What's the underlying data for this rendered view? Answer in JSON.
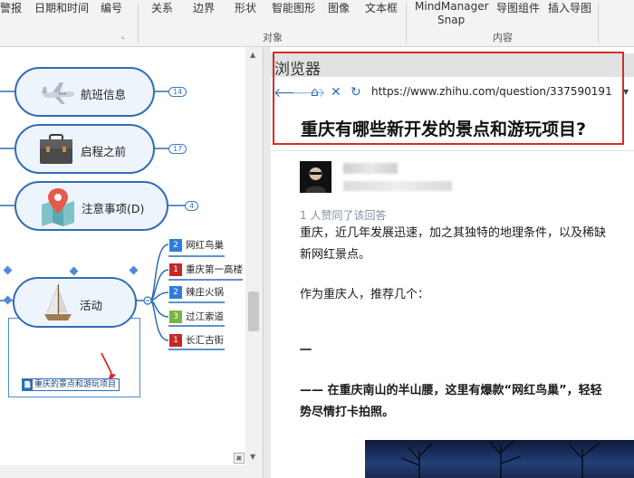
{
  "ribbon": {
    "items": [
      "警报",
      "日期和时间",
      "编号",
      "关系",
      "边界",
      "形状",
      "智能图形",
      "图像",
      "文本框",
      "MindManager",
      "Snap",
      "导图组件",
      "插入导图"
    ],
    "groups": [
      "对象",
      "内容"
    ]
  },
  "mindmap": {
    "nodes": [
      {
        "label": "航班信息",
        "badge": "14",
        "icon": "airplane-icon"
      },
      {
        "label": "启程之前",
        "badge": "17",
        "icon": "briefcase-icon"
      },
      {
        "label": "注意事项(D)",
        "badge": "4",
        "icon": "map-pin-icon"
      },
      {
        "label": "活动",
        "icon": "sailboat-icon"
      }
    ],
    "subtopics": [
      {
        "num": "2",
        "color": "blue",
        "label": "网红鸟巢"
      },
      {
        "num": "1",
        "color": "red",
        "label": "重庆第一高楼"
      },
      {
        "num": "2",
        "color": "blue",
        "label": "辣庄火锅"
      },
      {
        "num": "3",
        "color": "green",
        "label": "过江索道"
      },
      {
        "num": "1",
        "color": "red",
        "label": "长汇古街"
      }
    ],
    "note": "重庆的景点和游玩项目"
  },
  "browser": {
    "title": "浏览器",
    "url": "https://www.zhihu.com/question/337590191",
    "question": "重庆有哪些新开发的景点和游玩项目?",
    "likes": "1 人赞同了该回答",
    "p1_line1": "重庆，近几年发展迅速，加之其独特的地理条件，以及稀缺",
    "p1_line2": "新网红景点。",
    "p2": "作为重庆人，推荐几个：",
    "p3": "一",
    "p4_line1": "—— 在重庆南山的半山腰，这里有爆款“网红鸟巢”，轻轻",
    "p4_line2": "势尽情打卡拍照。"
  },
  "colors": {
    "accent": "#2f6db5",
    "highlight": "#d62c2c"
  }
}
